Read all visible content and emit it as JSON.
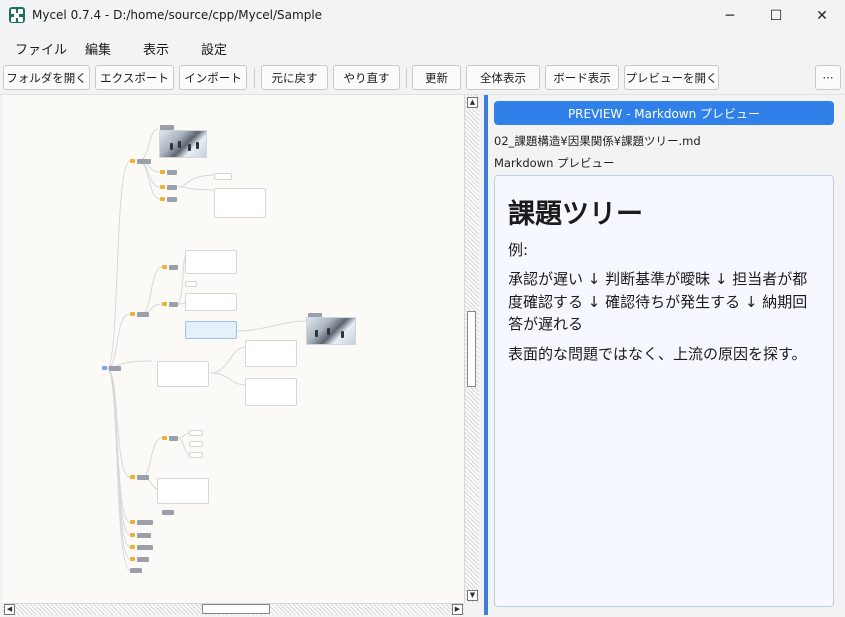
{
  "window": {
    "title": "Mycel 0.7.4 - D:/home/source/cpp/Mycel/Sample",
    "controls": {
      "minimize": "─",
      "maximize": "☐",
      "close": "✕"
    }
  },
  "menu": [
    "ファイル",
    "編集",
    "表示",
    "設定"
  ],
  "toolbar": {
    "open_folder": "フォルダを開く",
    "export": "エクスポート",
    "import": "インポート",
    "undo": "元に戻す",
    "redo": "やり直す",
    "refresh": "更新",
    "show_all": "全体表示",
    "board_view": "ボード表示",
    "open_preview": "プレビューを開く",
    "more": "···"
  },
  "preview": {
    "header": "PREVIEW - Markdown プレビュー",
    "path": "02_課題構造¥因果関係¥課題ツリー.md",
    "label": "Markdown プレビュー",
    "heading": "課題ツリー",
    "para_example": "例:",
    "para_chain": "承認が遅い ↓ 判断基準が曖昧 ↓ 担当者が都度確認する ↓ 確認待ちが発生する ↓ 納期回答が遅れる",
    "para_conclusion": "表面的な問題ではなく、上流の原因を探す。"
  },
  "colors": {
    "accent": "#2f80e8",
    "splitter": "#3d7edb",
    "canvas_bg": "#fbfaf6",
    "folder": "#f0b030",
    "preview_box_bg": "#f5f9ff"
  },
  "icons": {
    "app": "mycel-app-icon",
    "folder": "folder-icon",
    "scroll_up": "▲",
    "scroll_down": "▼",
    "scroll_left": "◀",
    "scroll_right": "▶"
  }
}
